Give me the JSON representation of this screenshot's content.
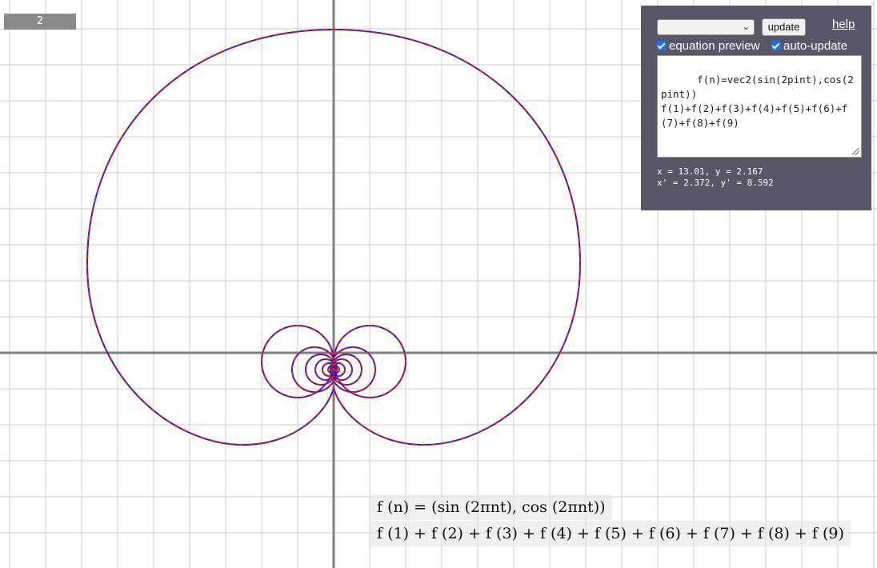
{
  "scale_indicator": "2",
  "panel": {
    "select_value": "",
    "update_label": "update",
    "help_label": "help",
    "equation_preview_label": "equation preview",
    "equation_preview_checked": true,
    "auto_update_label": "auto-update",
    "auto_update_checked": true,
    "editor_text": "f(n)=vec2(sin(2pint),cos(2pint))\nf(1)+f(2)+f(3)+f(4)+f(5)+f(6)+f(7)+f(8)+f(9)",
    "coord_line_1": "x = 13.01, y = 2.167",
    "coord_line_2": "x' = 2.372, y' = 8.592"
  },
  "equations": {
    "line_1": "f (n) = (sin (2πnt), cos (2πnt))",
    "line_2": "f (1) + f (2) + f (3) + f (4) + f (5) + f (6) + f (7) + f (8) + f (9)"
  },
  "colors": {
    "curve_primary": "#1f1fe0",
    "curve_secondary": "#e01a1a",
    "grid": "#cccccc",
    "axis": "#808080",
    "panel_bg": "#595668"
  }
}
